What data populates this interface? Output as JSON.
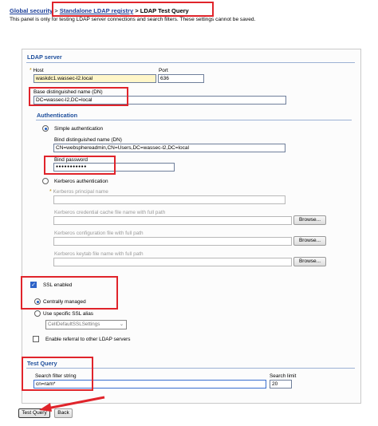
{
  "breadcrumb": {
    "item1": "Global security",
    "sep1": ">",
    "item2": "Standalone LDAP registry",
    "sep2": ">",
    "current": "LDAP Test Query"
  },
  "description": "This panel is only for testing LDAP server connections and search filters. These settings cannot be saved.",
  "ldap_server": {
    "title": "LDAP server",
    "host_label": "Host",
    "host_value": "waskdc1.wassec-l2.local",
    "port_label": "Port",
    "port_value": "636",
    "base_dn_label": "Base distinguished name (DN)",
    "base_dn_value": "DC=wassec-l2,DC=local",
    "required_marker": "*"
  },
  "authentication": {
    "title": "Authentication",
    "simple_label": "Simple authentication",
    "bind_dn_label": "Bind distinguished name (DN)",
    "bind_dn_value": "CN=websphereadmin,CN=Users,DC=wassec-l2,DC=local",
    "bind_password_label": "Bind password",
    "bind_password_value": "●●●●●●●●●●●",
    "kerberos_label": "Kerberos authentication",
    "kerberos_principal_label": "Kerberos principal name",
    "kerberos_cache_label": "Kerberos credential cache file name with full path",
    "kerberos_config_label": "Kerberos configuration file with full path",
    "kerberos_keytab_label": "Kerberos keytab file name with full path",
    "browse_label": "Browse..."
  },
  "ssl": {
    "enabled_label": "SSL enabled",
    "centrally_managed_label": "Centrally managed",
    "specific_alias_label": "Use specific SSL alias",
    "alias_value": "CellDefaultSSLSettings"
  },
  "referral": {
    "label": "Enable referral to other LDAP servers"
  },
  "test_query": {
    "title": "Test Query",
    "filter_label": "Search filter string",
    "filter_value": "cn=ram*",
    "limit_label": "Search limit",
    "limit_value": "20"
  },
  "buttons": {
    "test_query": "Test Query",
    "back": "Back"
  },
  "colors": {
    "highlight": "#e0242b",
    "link": "#1a3e9a",
    "section_title": "#1d4e9c"
  }
}
